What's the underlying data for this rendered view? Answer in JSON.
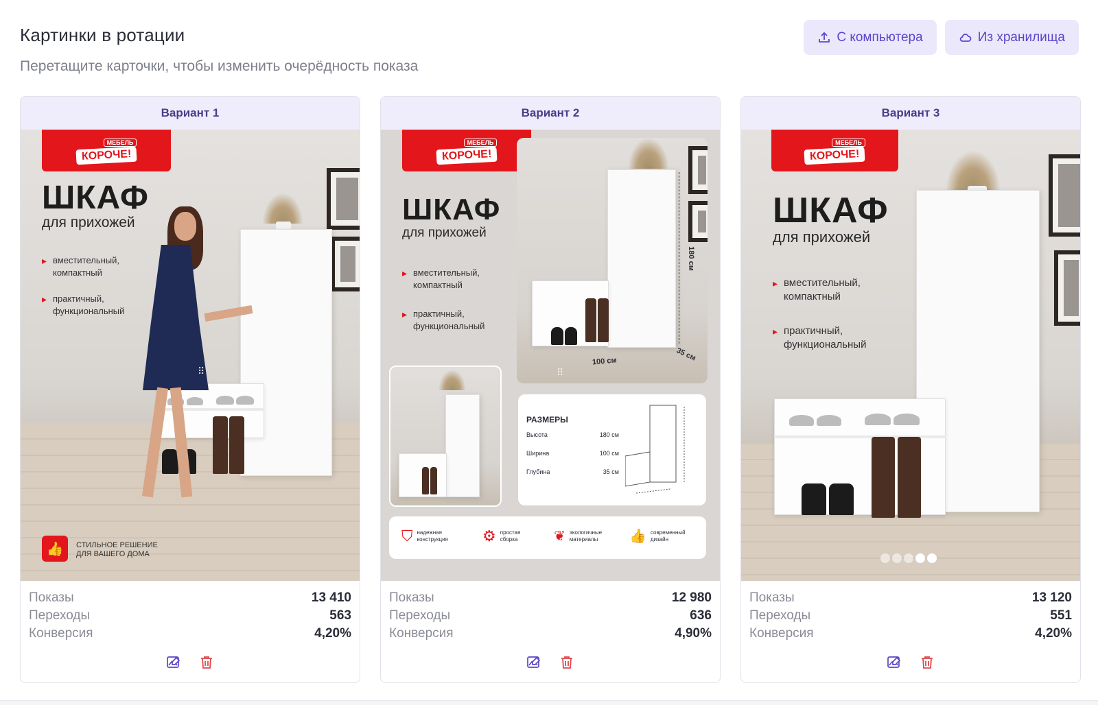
{
  "header": {
    "title": "Картинки в ротации",
    "subtitle": "Перетащите карточки, чтобы изменить очерёдность показа"
  },
  "actions": {
    "upload_computer": "С компьютера",
    "upload_storage": "Из хранилища"
  },
  "creative": {
    "logo_top": "МЕБЕЛЬ",
    "logo_main": "КОРОЧЕ!",
    "title": "ШКАФ",
    "subtitle": "для прихожей",
    "bullet1": "вместительный, компактный",
    "bullet2": "практичный, функциональный",
    "slogan": "СТИЛЬНОЕ РЕШЕНИЕ ДЛЯ ВАШЕГО ДОМА",
    "dim_height_label": "180 см",
    "dim_width_label": "100 см",
    "dim_depth_label": "35 см",
    "sizes_title": "РАЗМЕРЫ",
    "size_rows": [
      {
        "label": "Высота",
        "value": "180 см"
      },
      {
        "label": "Ширина",
        "value": "100 см"
      },
      {
        "label": "Глубина",
        "value": "35 см"
      }
    ],
    "features": [
      "надежная конструкция",
      "простая сборка",
      "экологичные материалы",
      "современный дизайн"
    ]
  },
  "stat_labels": {
    "impressions": "Показы",
    "clicks": "Переходы",
    "conversion": "Конверсия"
  },
  "cards": [
    {
      "title": "Вариант 1",
      "impressions": "13 410",
      "clicks": "563",
      "conversion": "4,20%"
    },
    {
      "title": "Вариант 2",
      "impressions": "12 980",
      "clicks": "636",
      "conversion": "4,90%"
    },
    {
      "title": "Вариант 3",
      "impressions": "13 120",
      "clicks": "551",
      "conversion": "4,20%"
    }
  ],
  "carousel": {
    "total_slides": 5,
    "active_slide": 4
  },
  "colors": {
    "accent": "#5b45c8",
    "brand_red": "#e3161b",
    "delete": "#e0474c"
  }
}
